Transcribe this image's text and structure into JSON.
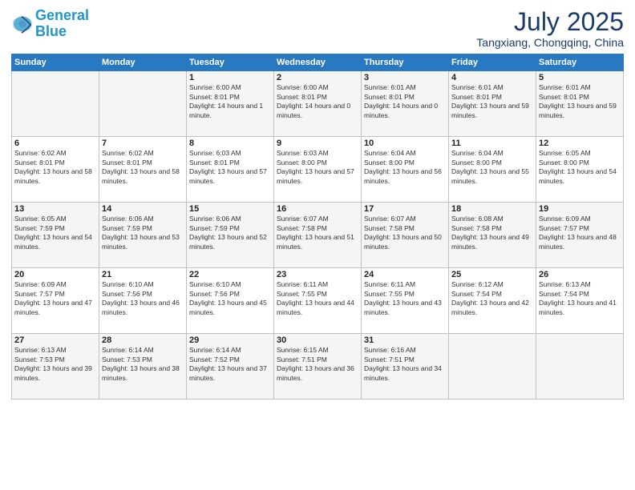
{
  "header": {
    "logo_line1": "General",
    "logo_line2": "Blue",
    "month_year": "July 2025",
    "location": "Tangxiang, Chongqing, China"
  },
  "weekdays": [
    "Sunday",
    "Monday",
    "Tuesday",
    "Wednesday",
    "Thursday",
    "Friday",
    "Saturday"
  ],
  "weeks": [
    [
      {
        "day": "",
        "sunrise": "",
        "sunset": "",
        "daylight": ""
      },
      {
        "day": "",
        "sunrise": "",
        "sunset": "",
        "daylight": ""
      },
      {
        "day": "1",
        "sunrise": "Sunrise: 6:00 AM",
        "sunset": "Sunset: 8:01 PM",
        "daylight": "Daylight: 14 hours and 1 minute."
      },
      {
        "day": "2",
        "sunrise": "Sunrise: 6:00 AM",
        "sunset": "Sunset: 8:01 PM",
        "daylight": "Daylight: 14 hours and 0 minutes."
      },
      {
        "day": "3",
        "sunrise": "Sunrise: 6:01 AM",
        "sunset": "Sunset: 8:01 PM",
        "daylight": "Daylight: 14 hours and 0 minutes."
      },
      {
        "day": "4",
        "sunrise": "Sunrise: 6:01 AM",
        "sunset": "Sunset: 8:01 PM",
        "daylight": "Daylight: 13 hours and 59 minutes."
      },
      {
        "day": "5",
        "sunrise": "Sunrise: 6:01 AM",
        "sunset": "Sunset: 8:01 PM",
        "daylight": "Daylight: 13 hours and 59 minutes."
      }
    ],
    [
      {
        "day": "6",
        "sunrise": "Sunrise: 6:02 AM",
        "sunset": "Sunset: 8:01 PM",
        "daylight": "Daylight: 13 hours and 58 minutes."
      },
      {
        "day": "7",
        "sunrise": "Sunrise: 6:02 AM",
        "sunset": "Sunset: 8:01 PM",
        "daylight": "Daylight: 13 hours and 58 minutes."
      },
      {
        "day": "8",
        "sunrise": "Sunrise: 6:03 AM",
        "sunset": "Sunset: 8:01 PM",
        "daylight": "Daylight: 13 hours and 57 minutes."
      },
      {
        "day": "9",
        "sunrise": "Sunrise: 6:03 AM",
        "sunset": "Sunset: 8:00 PM",
        "daylight": "Daylight: 13 hours and 57 minutes."
      },
      {
        "day": "10",
        "sunrise": "Sunrise: 6:04 AM",
        "sunset": "Sunset: 8:00 PM",
        "daylight": "Daylight: 13 hours and 56 minutes."
      },
      {
        "day": "11",
        "sunrise": "Sunrise: 6:04 AM",
        "sunset": "Sunset: 8:00 PM",
        "daylight": "Daylight: 13 hours and 55 minutes."
      },
      {
        "day": "12",
        "sunrise": "Sunrise: 6:05 AM",
        "sunset": "Sunset: 8:00 PM",
        "daylight": "Daylight: 13 hours and 54 minutes."
      }
    ],
    [
      {
        "day": "13",
        "sunrise": "Sunrise: 6:05 AM",
        "sunset": "Sunset: 7:59 PM",
        "daylight": "Daylight: 13 hours and 54 minutes."
      },
      {
        "day": "14",
        "sunrise": "Sunrise: 6:06 AM",
        "sunset": "Sunset: 7:59 PM",
        "daylight": "Daylight: 13 hours and 53 minutes."
      },
      {
        "day": "15",
        "sunrise": "Sunrise: 6:06 AM",
        "sunset": "Sunset: 7:59 PM",
        "daylight": "Daylight: 13 hours and 52 minutes."
      },
      {
        "day": "16",
        "sunrise": "Sunrise: 6:07 AM",
        "sunset": "Sunset: 7:58 PM",
        "daylight": "Daylight: 13 hours and 51 minutes."
      },
      {
        "day": "17",
        "sunrise": "Sunrise: 6:07 AM",
        "sunset": "Sunset: 7:58 PM",
        "daylight": "Daylight: 13 hours and 50 minutes."
      },
      {
        "day": "18",
        "sunrise": "Sunrise: 6:08 AM",
        "sunset": "Sunset: 7:58 PM",
        "daylight": "Daylight: 13 hours and 49 minutes."
      },
      {
        "day": "19",
        "sunrise": "Sunrise: 6:09 AM",
        "sunset": "Sunset: 7:57 PM",
        "daylight": "Daylight: 13 hours and 48 minutes."
      }
    ],
    [
      {
        "day": "20",
        "sunrise": "Sunrise: 6:09 AM",
        "sunset": "Sunset: 7:57 PM",
        "daylight": "Daylight: 13 hours and 47 minutes."
      },
      {
        "day": "21",
        "sunrise": "Sunrise: 6:10 AM",
        "sunset": "Sunset: 7:56 PM",
        "daylight": "Daylight: 13 hours and 46 minutes."
      },
      {
        "day": "22",
        "sunrise": "Sunrise: 6:10 AM",
        "sunset": "Sunset: 7:56 PM",
        "daylight": "Daylight: 13 hours and 45 minutes."
      },
      {
        "day": "23",
        "sunrise": "Sunrise: 6:11 AM",
        "sunset": "Sunset: 7:55 PM",
        "daylight": "Daylight: 13 hours and 44 minutes."
      },
      {
        "day": "24",
        "sunrise": "Sunrise: 6:11 AM",
        "sunset": "Sunset: 7:55 PM",
        "daylight": "Daylight: 13 hours and 43 minutes."
      },
      {
        "day": "25",
        "sunrise": "Sunrise: 6:12 AM",
        "sunset": "Sunset: 7:54 PM",
        "daylight": "Daylight: 13 hours and 42 minutes."
      },
      {
        "day": "26",
        "sunrise": "Sunrise: 6:13 AM",
        "sunset": "Sunset: 7:54 PM",
        "daylight": "Daylight: 13 hours and 41 minutes."
      }
    ],
    [
      {
        "day": "27",
        "sunrise": "Sunrise: 6:13 AM",
        "sunset": "Sunset: 7:53 PM",
        "daylight": "Daylight: 13 hours and 39 minutes."
      },
      {
        "day": "28",
        "sunrise": "Sunrise: 6:14 AM",
        "sunset": "Sunset: 7:53 PM",
        "daylight": "Daylight: 13 hours and 38 minutes."
      },
      {
        "day": "29",
        "sunrise": "Sunrise: 6:14 AM",
        "sunset": "Sunset: 7:52 PM",
        "daylight": "Daylight: 13 hours and 37 minutes."
      },
      {
        "day": "30",
        "sunrise": "Sunrise: 6:15 AM",
        "sunset": "Sunset: 7:51 PM",
        "daylight": "Daylight: 13 hours and 36 minutes."
      },
      {
        "day": "31",
        "sunrise": "Sunrise: 6:16 AM",
        "sunset": "Sunset: 7:51 PM",
        "daylight": "Daylight: 13 hours and 34 minutes."
      },
      {
        "day": "",
        "sunrise": "",
        "sunset": "",
        "daylight": ""
      },
      {
        "day": "",
        "sunrise": "",
        "sunset": "",
        "daylight": ""
      }
    ]
  ]
}
